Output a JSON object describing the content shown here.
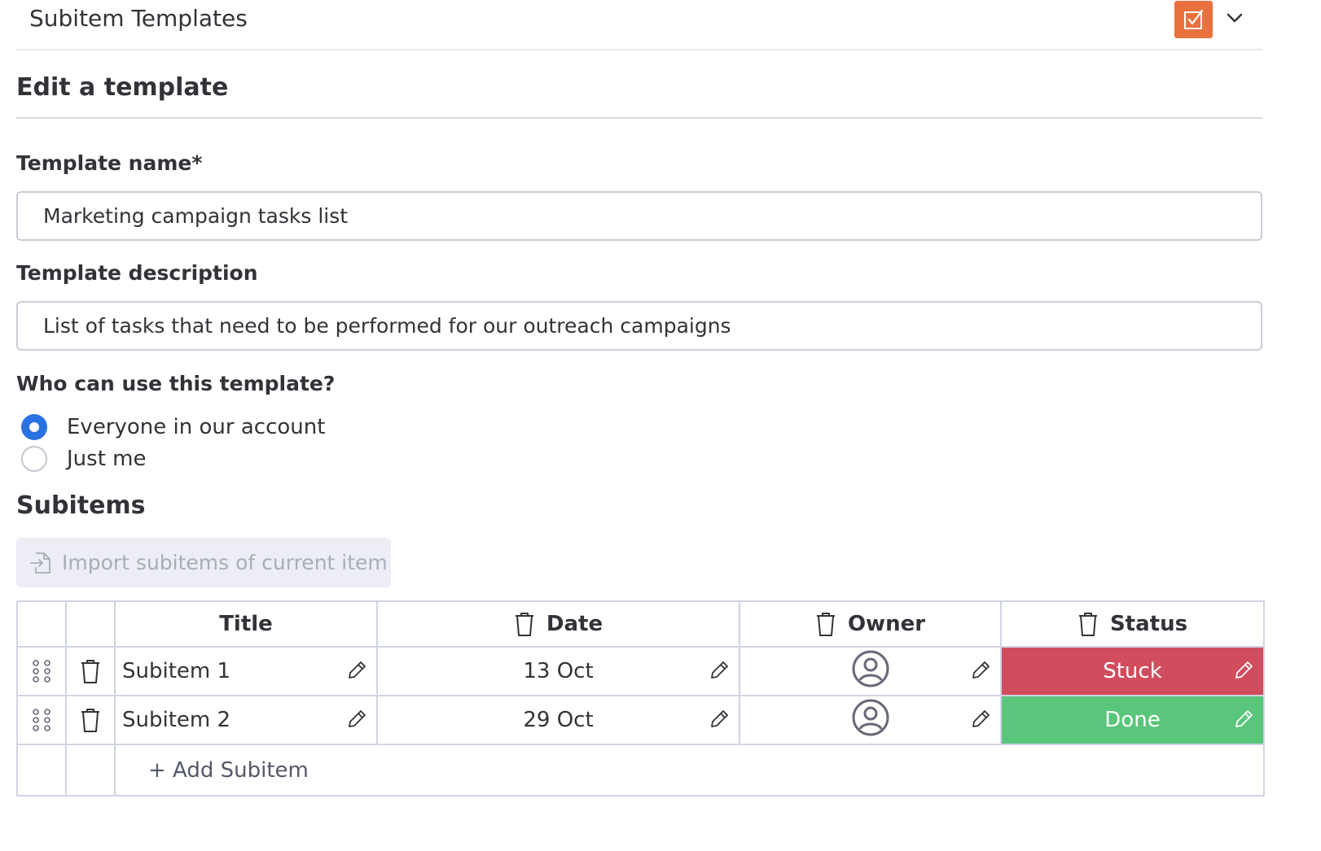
{
  "header": {
    "title": "Subitem Templates",
    "app_icon": "checkbox-icon",
    "accent_color": "#e8713e"
  },
  "editor": {
    "heading": "Edit a template",
    "name_label": "Template name*",
    "name_value": "Marketing campaign tasks list",
    "description_label": "Template description",
    "description_value": "List of tasks that need to be performed for our outreach campaigns",
    "visibility_label": "Who can use this template?",
    "visibility_options": [
      {
        "label": "Everyone in our account",
        "selected": true
      },
      {
        "label": "Just me",
        "selected": false
      }
    ]
  },
  "subitems": {
    "heading": "Subitems",
    "import_label": "Import subitems of current item",
    "columns": {
      "title": "Title",
      "date": "Date",
      "owner": "Owner",
      "status": "Status"
    },
    "rows": [
      {
        "title": "Subitem 1",
        "date": "13 Oct",
        "owner_icon": "person-icon",
        "status": "Stuck",
        "status_color": "#d14d5e"
      },
      {
        "title": "Subitem 2",
        "date": "29 Oct",
        "owner_icon": "person-icon",
        "status": "Done",
        "status_color": "#59c67b"
      }
    ],
    "add_label": "+ Add Subitem"
  }
}
